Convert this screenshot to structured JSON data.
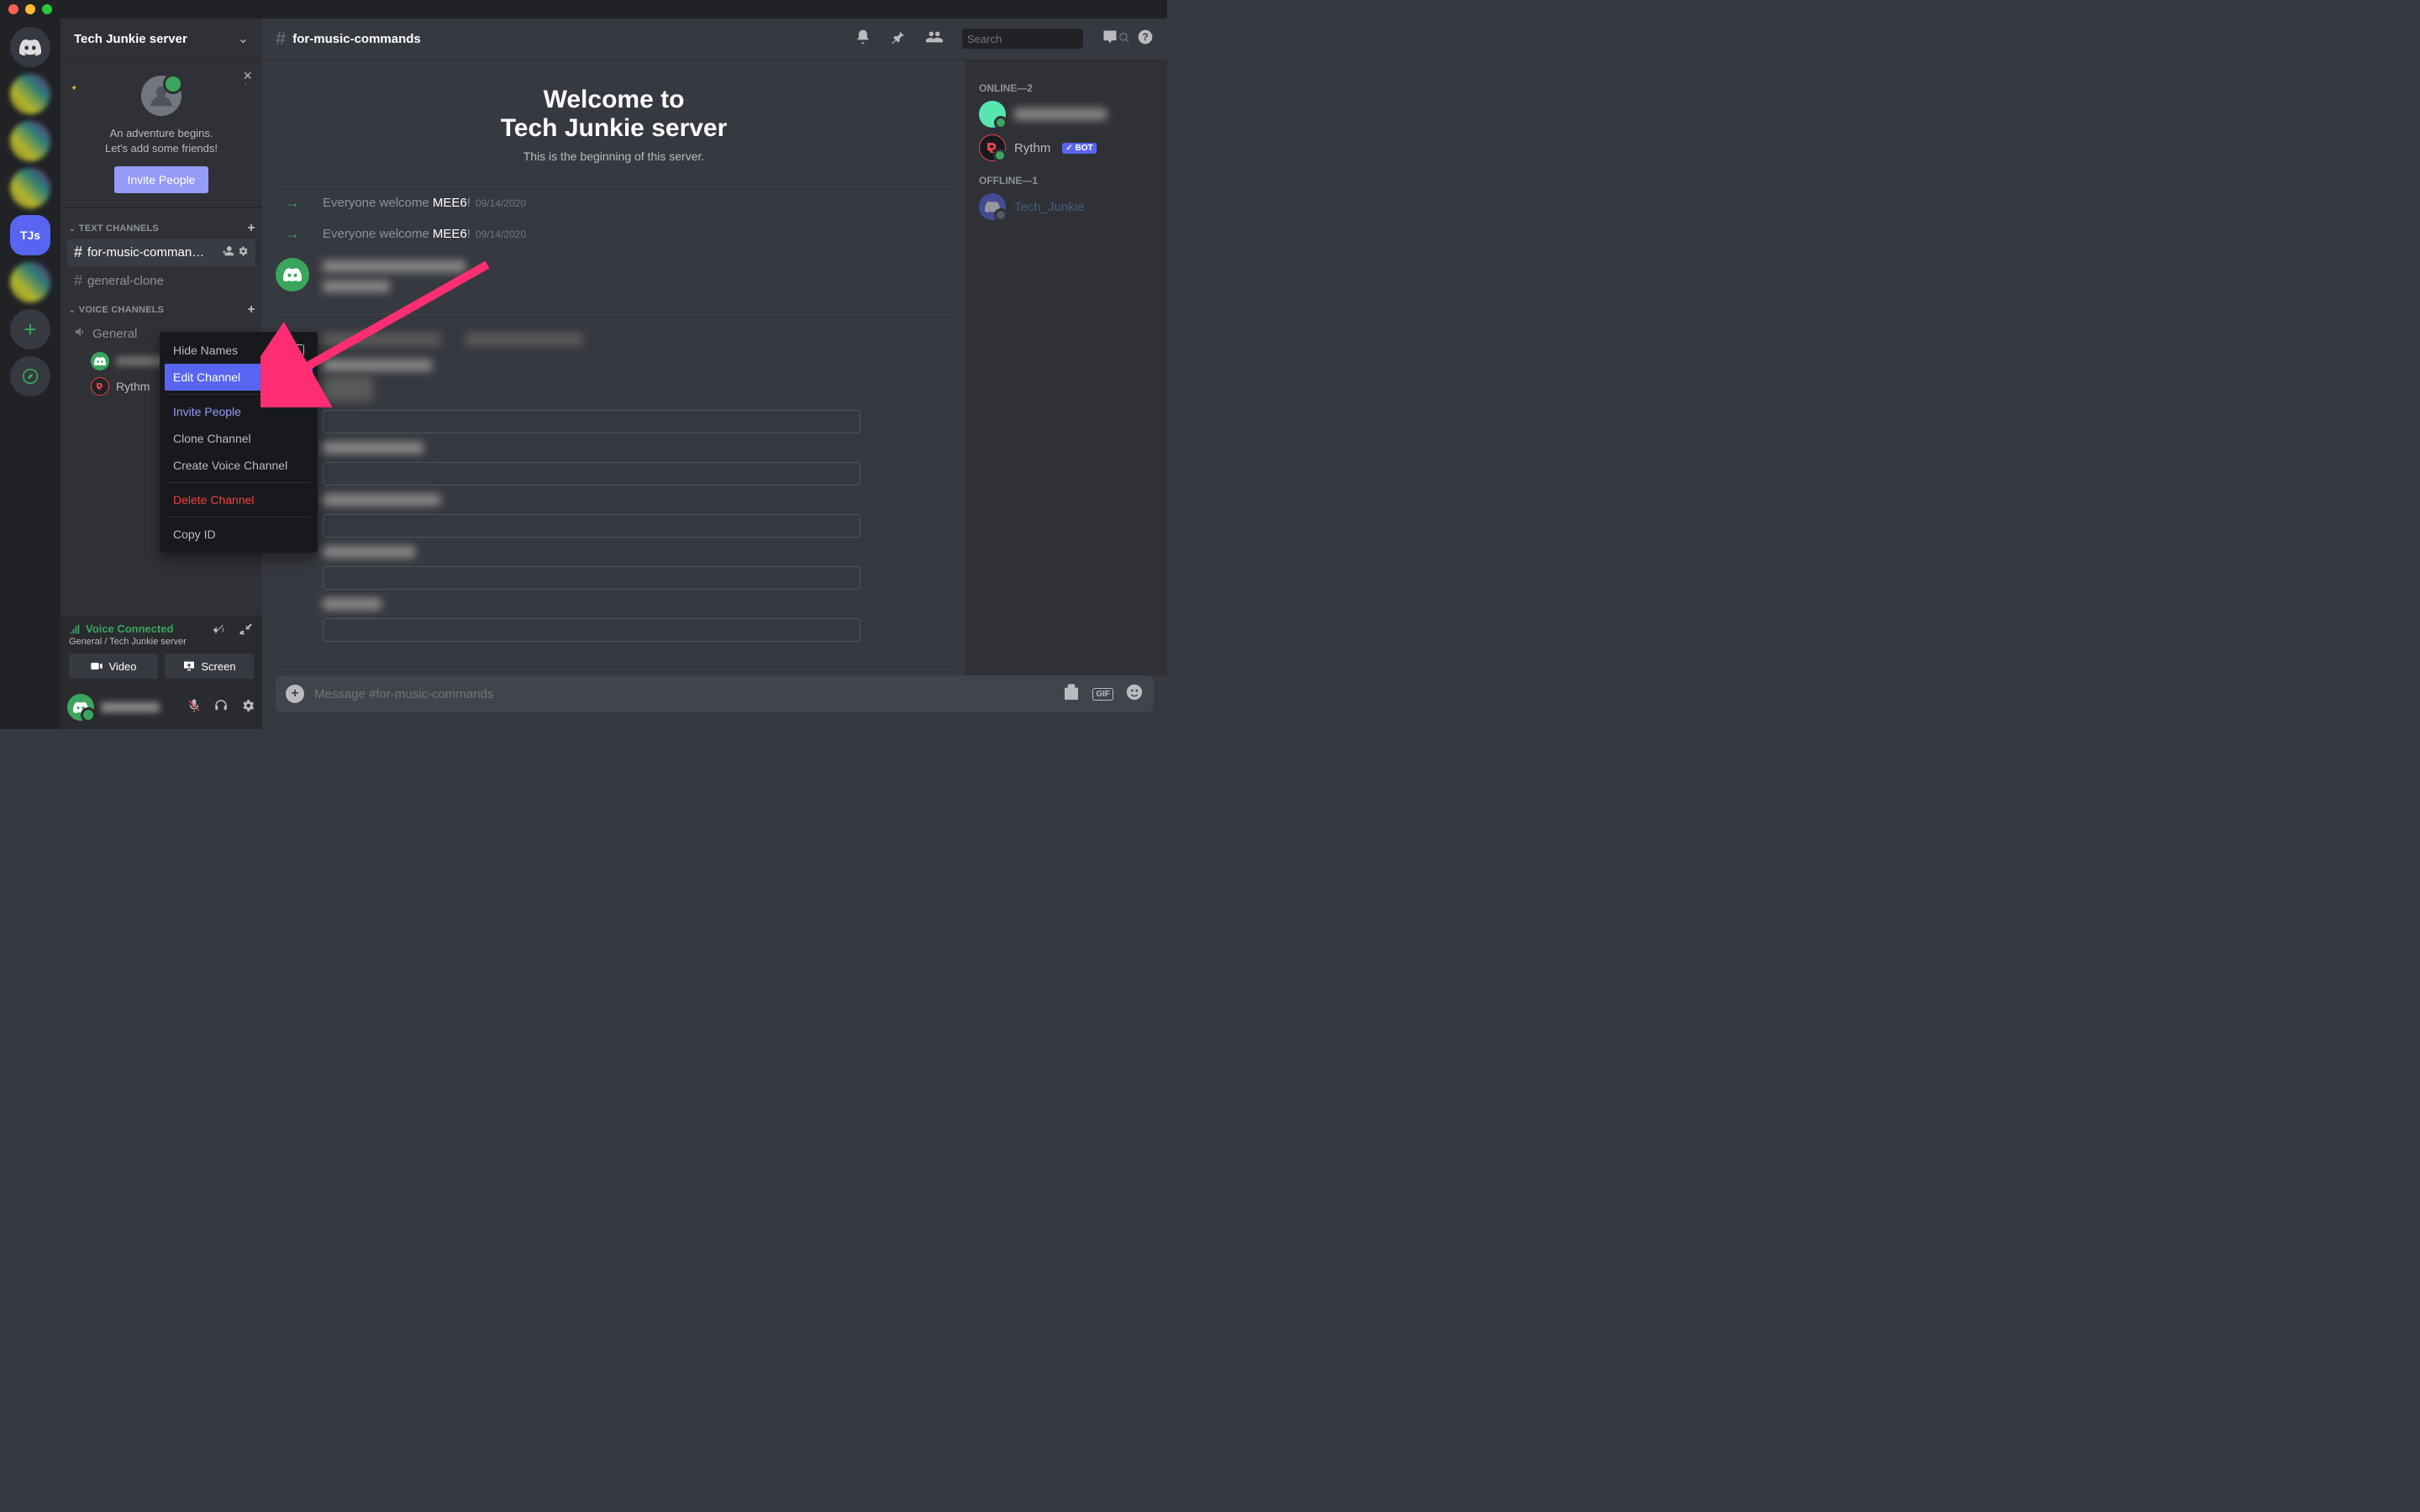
{
  "server": {
    "name": "Tech Junkie server",
    "active_initials": "TJs"
  },
  "invite_card": {
    "line1": "An adventure begins.",
    "line2": "Let's add some friends!",
    "button": "Invite People"
  },
  "categories": {
    "text_label": "TEXT CHANNELS",
    "voice_label": "VOICE CHANNELS"
  },
  "channels": {
    "text": [
      {
        "name": "for-music-comman…",
        "selected": true
      },
      {
        "name": "general-clone",
        "selected": false
      }
    ],
    "voice": [
      {
        "name": "General"
      }
    ],
    "voice_members": [
      {
        "name": "(blurred)"
      },
      {
        "name": "Rythm"
      }
    ]
  },
  "voice_panel": {
    "status": "Voice Connected",
    "sub": "General / Tech Junkie server",
    "video": "Video",
    "screen": "Screen"
  },
  "chat": {
    "channel_title": "for-music-commands",
    "search_placeholder": "Search",
    "welcome_top": "Welcome to",
    "welcome_name": "Tech Junkie server",
    "welcome_sub": "This is the beginning of this server.",
    "sys1_prefix": "Everyone welcome ",
    "sys1_user": "MEE6",
    "sys1_date": "09/14/2020",
    "sys2_prefix": "Everyone welcome ",
    "sys2_user": "MEE6",
    "sys2_date": "09/14/2020",
    "input_placeholder": "Message #for-music-commands"
  },
  "members": {
    "online_label": "ONLINE—2",
    "offline_label": "OFFLINE—1",
    "rythm": "Rythm",
    "bot_tag": "✓ BOT",
    "tech_junkie": "Tech_Junkie"
  },
  "context_menu": {
    "hide_names": "Hide Names",
    "edit_channel": "Edit Channel",
    "invite_people": "Invite People",
    "clone_channel": "Clone Channel",
    "create_voice": "Create Voice Channel",
    "delete_channel": "Delete Channel",
    "copy_id": "Copy ID"
  }
}
